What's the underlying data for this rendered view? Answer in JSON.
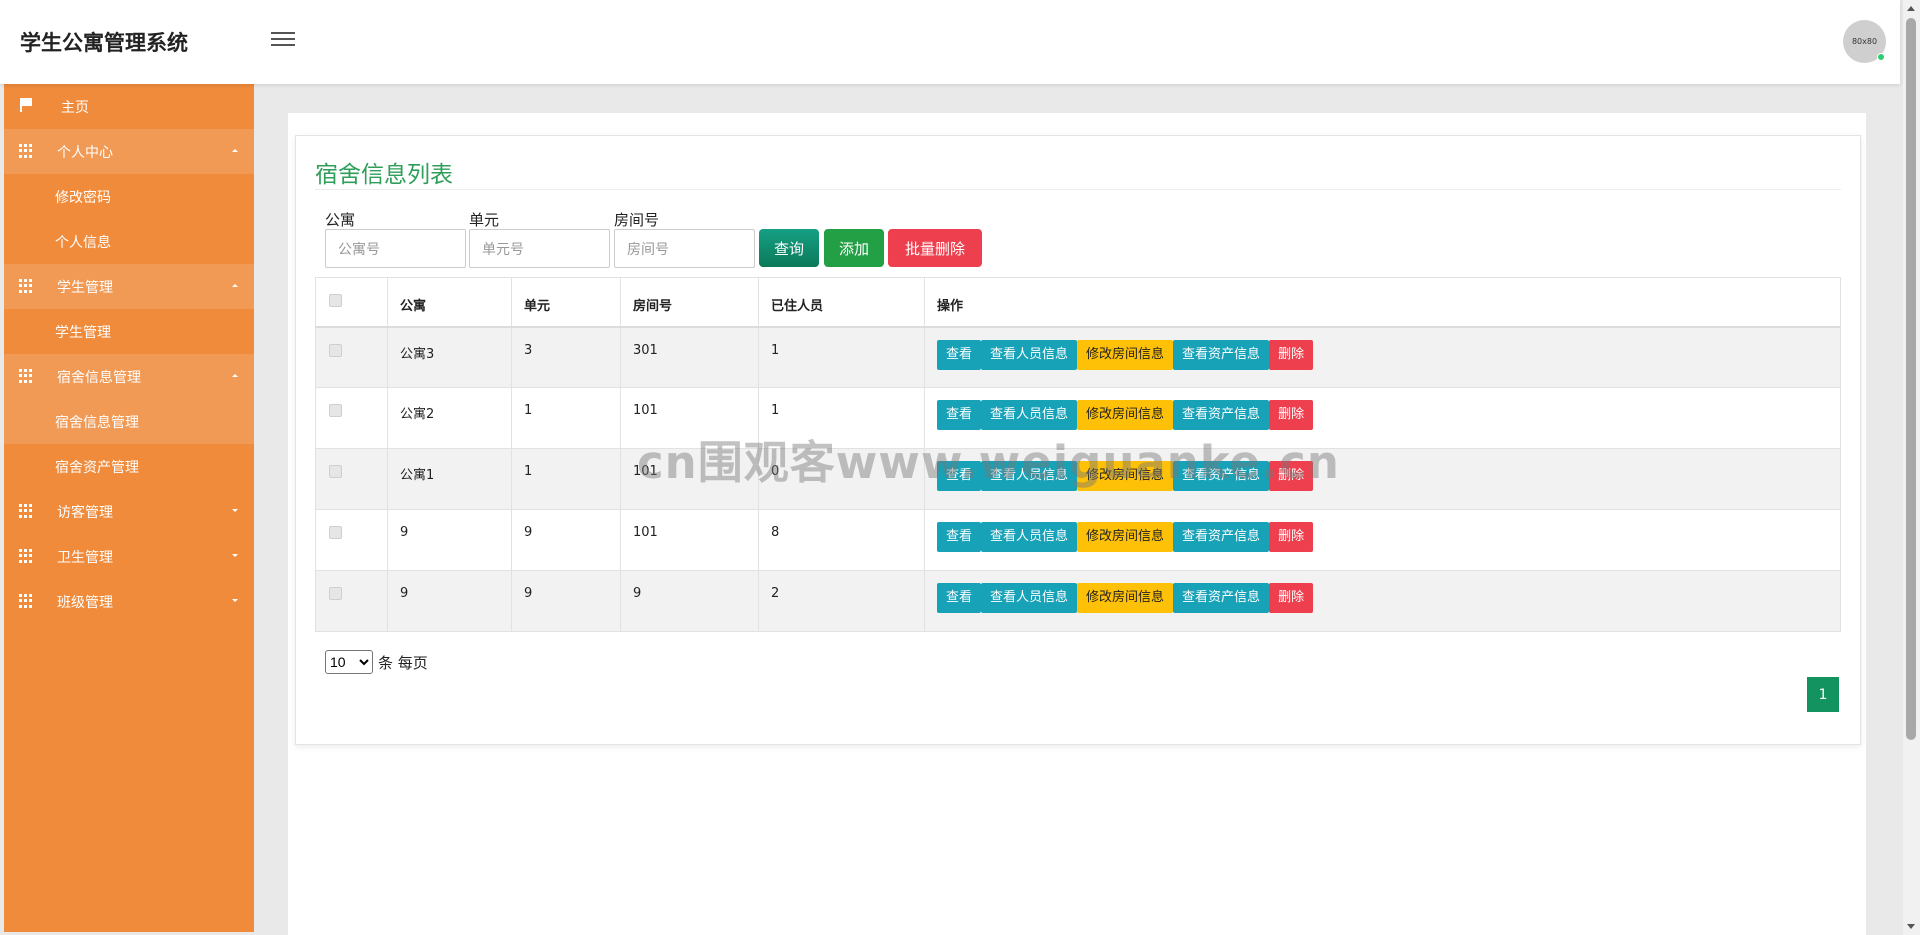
{
  "header": {
    "app_title": "学生公寓管理系统",
    "avatar_text": "80x80"
  },
  "sidebar": {
    "home": "主页",
    "groups": [
      {
        "label": "个人中心",
        "children": [
          "修改密码",
          "个人信息"
        ]
      },
      {
        "label": "学生管理",
        "children": [
          "学生管理"
        ]
      },
      {
        "label": "宿舍信息管理",
        "children": [
          "宿舍信息管理",
          "宿舍资产管理"
        ]
      },
      {
        "label": "访客管理",
        "children": []
      },
      {
        "label": "卫生管理",
        "children": []
      },
      {
        "label": "班级管理",
        "children": []
      }
    ]
  },
  "panel": {
    "title": "宿舍信息列表"
  },
  "filters": {
    "apartment": {
      "label": "公寓",
      "placeholder": "公寓号",
      "value": ""
    },
    "unit": {
      "label": "单元",
      "placeholder": "单元号",
      "value": ""
    },
    "room": {
      "label": "房间号",
      "placeholder": "房间号",
      "value": ""
    }
  },
  "buttons": {
    "query": "查询",
    "add": "添加",
    "batch_delete": "批量删除"
  },
  "table": {
    "columns": [
      "公寓",
      "单元",
      "房间号",
      "已住人员",
      "操作"
    ],
    "rows": [
      {
        "apartment": "公寓3",
        "unit": "3",
        "room": "301",
        "occupants": "1"
      },
      {
        "apartment": "公寓2",
        "unit": "1",
        "room": "101",
        "occupants": "1"
      },
      {
        "apartment": "公寓1",
        "unit": "1",
        "room": "101",
        "occupants": "0"
      },
      {
        "apartment": "9",
        "unit": "9",
        "room": "101",
        "occupants": "8"
      },
      {
        "apartment": "9",
        "unit": "9",
        "room": "9",
        "occupants": "2"
      }
    ],
    "actions": [
      "查看",
      "查看人员信息",
      "修改房间信息",
      "查看资产信息",
      "删除"
    ]
  },
  "pagination": {
    "page_size": "10",
    "page_size_suffix": "条 每页",
    "current_page": "1"
  },
  "watermark": "cn围观客www.weiguanke.cn",
  "colors": {
    "sidebar": "#ef8b3b",
    "title": "#2f9e5a",
    "primary": "#17a2b8",
    "warning": "#ffc107",
    "danger": "#ee3f4e",
    "success": "#23a046"
  }
}
